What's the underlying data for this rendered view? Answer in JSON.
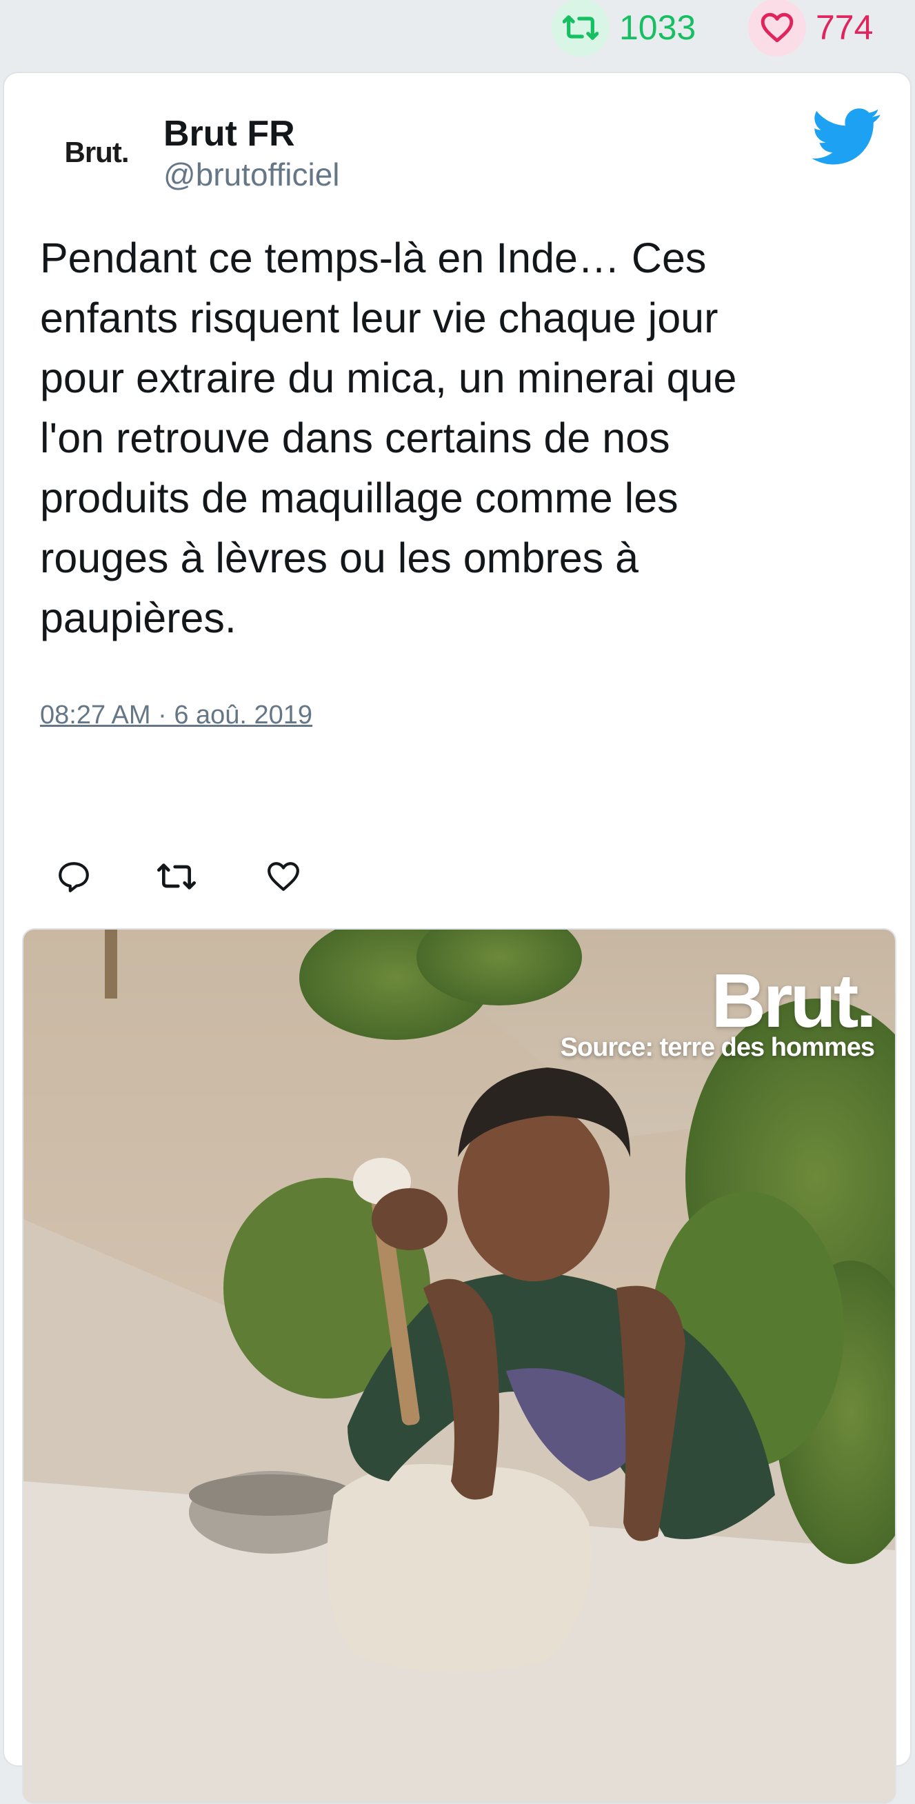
{
  "stats": {
    "retweets": "1033",
    "likes": "774"
  },
  "tweet": {
    "author_name": "Brut FR",
    "author_handle": "@brutofficiel",
    "avatar_text": "Brut.",
    "text": "Pendant ce temps-là en Inde… Ces\nenfants risquent leur vie chaque jour\npour extraire du mica, un minerai que\nl'on retrouve dans certains de nos\nproduits de maquillage comme les\nrouges à lèvres ou les ombres à\npaupières.",
    "timestamp": "08:27 AM · 6 aoû. 2019"
  },
  "media": {
    "brand": "Brut.",
    "source": "Source: terre des hommes"
  },
  "icons": {
    "retweet": "retweet-icon",
    "like": "heart-icon",
    "reply": "reply-icon",
    "platform": "twitter-bird-icon"
  },
  "colors": {
    "retweet": "#17bf63",
    "like": "#e0245e",
    "twitter_blue": "#1da1f2",
    "muted_text": "#657786"
  }
}
